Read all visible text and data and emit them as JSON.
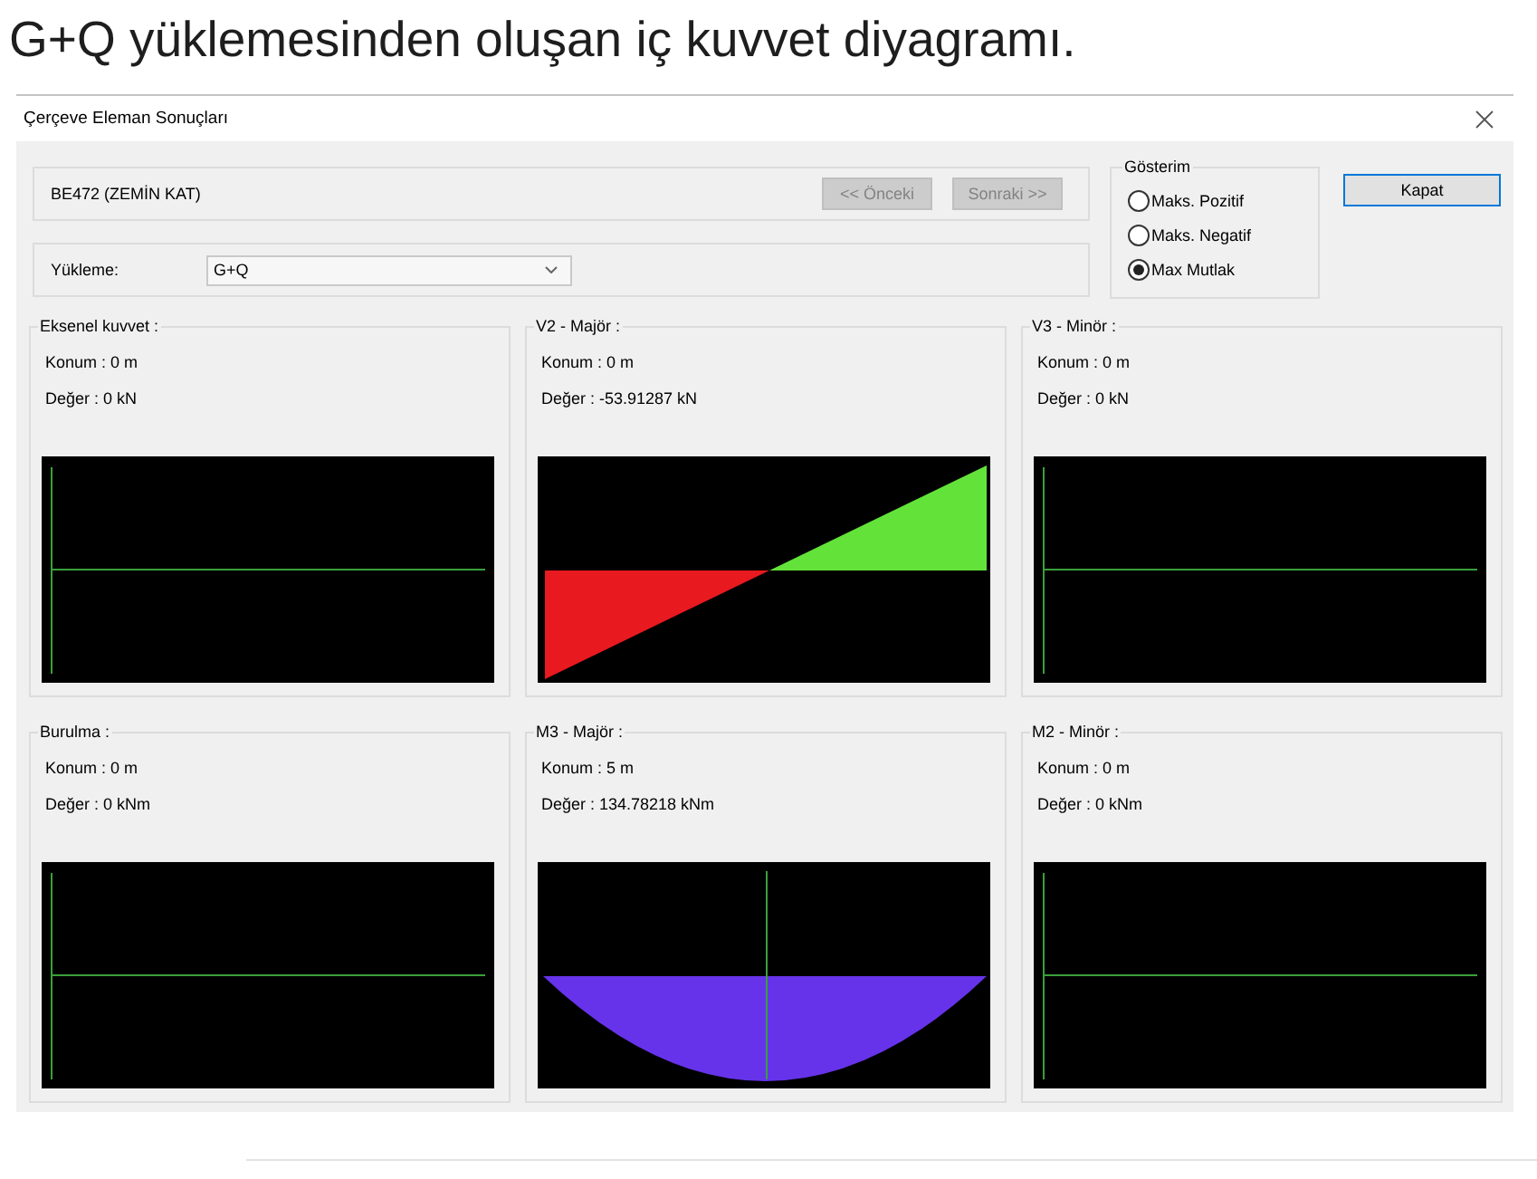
{
  "caption": "G+Q yüklemesinden oluşan iç kuvvet diyagramı.",
  "window": {
    "title": "Çerçeve Eleman Sonuçları"
  },
  "element": {
    "name": "BE472 (ZEMİN KAT)",
    "buttons": [
      {
        "label": "<< Önceki",
        "disabled": true
      },
      {
        "label": "Sonraki >>",
        "disabled": true
      }
    ]
  },
  "loading": {
    "label": "Yükleme:",
    "value": "G+Q"
  },
  "display": {
    "title": "Gösterim",
    "options": [
      {
        "label": "Maks. Pozitif",
        "selected": false
      },
      {
        "label": "Maks. Negatif",
        "selected": false
      },
      {
        "label": "Max Mutlak",
        "selected": true
      }
    ]
  },
  "close_button": {
    "label": "Kapat",
    "default": true
  },
  "panels": [
    {
      "title": "Eksenel kuvvet :",
      "position": "Konum : 0 m",
      "value": "Değer : 0 kN",
      "kind": "flat"
    },
    {
      "title": "V2 - Majör :",
      "position": "Konum : 0 m",
      "value": "Değer : -53.91287 kN",
      "kind": "shear"
    },
    {
      "title": "V3 - Minör :",
      "position": "Konum : 0 m",
      "value": "Değer : 0 kN",
      "kind": "flat"
    },
    {
      "title": "Burulma :",
      "position": "Konum : 0 m",
      "value": "Değer : 0 kNm",
      "kind": "flat"
    },
    {
      "title": "M3 - Majör :",
      "position": "Konum : 5 m",
      "value": "Değer : 134.78218 kNm",
      "kind": "moment"
    },
    {
      "title": "M2 - Minör :",
      "position": "Konum : 0 m",
      "value": "Değer : 0 kNm",
      "kind": "flat"
    }
  ]
}
